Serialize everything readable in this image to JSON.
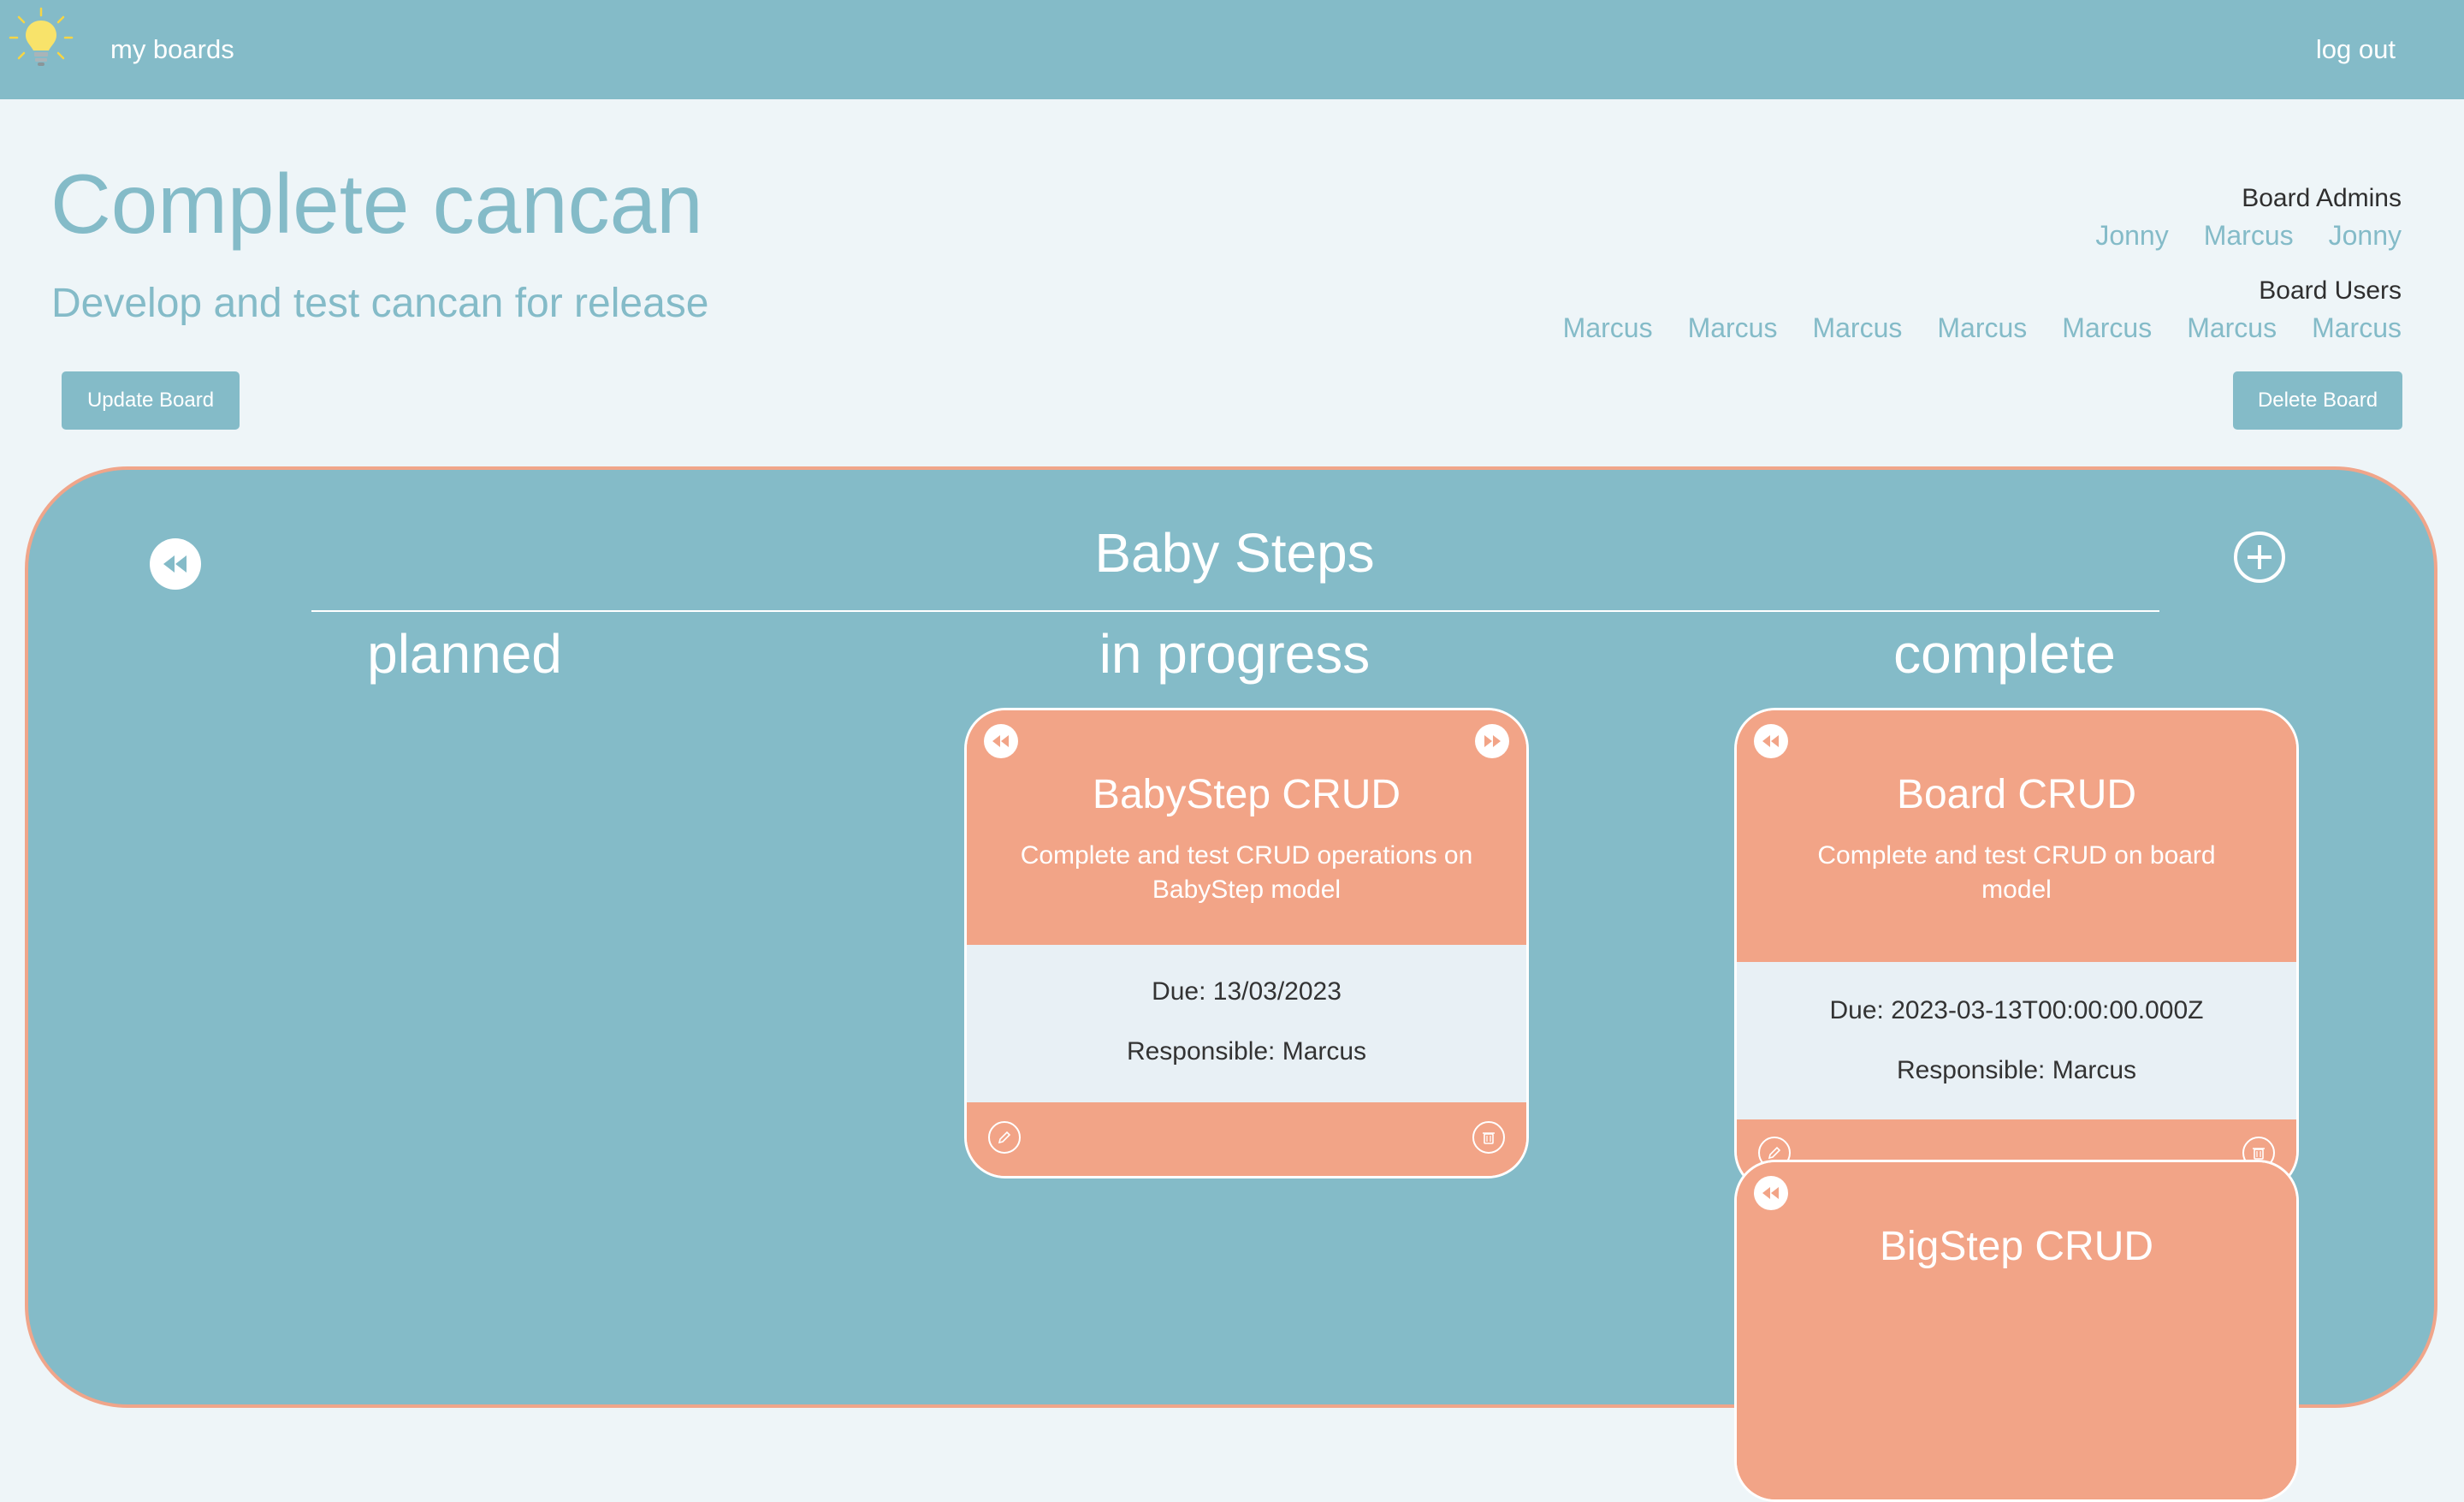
{
  "nav": {
    "my_boards": "my boards",
    "log_out": "log out",
    "logo_icon": "lightbulb-icon"
  },
  "board": {
    "title": "Complete cancan",
    "description": "Develop and test cancan for release",
    "admins_heading": "Board Admins",
    "admins": [
      "Jonny",
      "Marcus",
      "Jonny"
    ],
    "users_heading": "Board Users",
    "users": [
      "Marcus",
      "Marcus",
      "Marcus",
      "Marcus",
      "Marcus",
      "Marcus",
      "Marcus"
    ],
    "update_button": "Update Board",
    "delete_button": "Delete Board"
  },
  "baby_step": {
    "title": "Baby Steps",
    "columns": {
      "planned": "planned",
      "in_progress": "in progress",
      "complete": "complete"
    },
    "cards": [
      {
        "title": "BabyStep CRUD",
        "description": "Complete and test CRUD operations on BabyStep model",
        "due": "Due: 13/03/2023",
        "responsible": "Responsible: Marcus"
      },
      {
        "title": "Board CRUD",
        "description": "Complete and test CRUD on board model",
        "due": "Due: 2023-03-13T00:00:00.000Z",
        "responsible": "Responsible: Marcus"
      },
      {
        "title": "BigStep CRUD"
      }
    ]
  },
  "colors": {
    "primary": "#84bbc8",
    "accent": "#f2a487",
    "background": "#eef5f8",
    "card_body": "#e8f0f5"
  }
}
